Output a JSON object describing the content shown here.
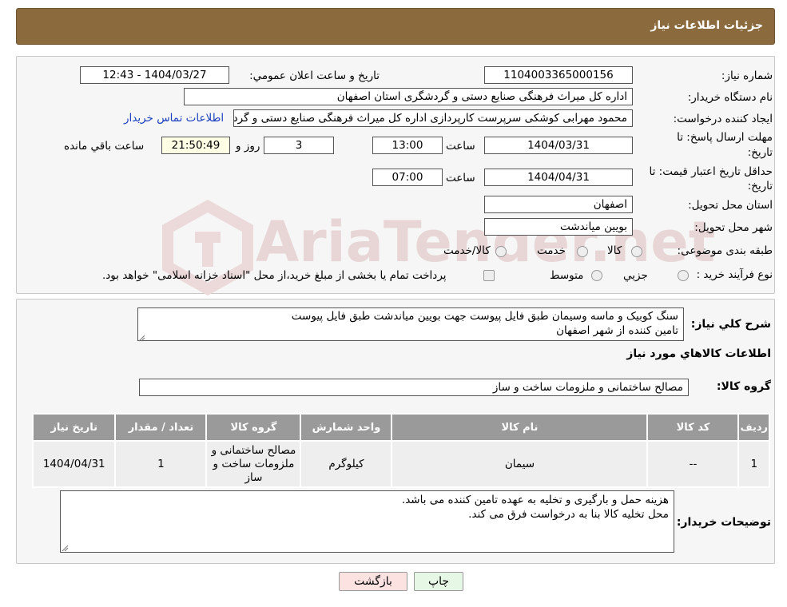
{
  "header": {
    "title": "جزئیات اطلاعات نیاز"
  },
  "info": {
    "need_number_label": "شماره نیاز:",
    "need_number": "1104003365000156",
    "announce_label": "تاریخ و ساعت اعلان عمومي:",
    "announce_value": "1404/03/27 - 12:43",
    "buyer_label": "نام دستگاه خريدار:",
    "buyer_value": "اداره کل میراث فرهنگی  صنایع دستی و گردشگری استان اصفهان",
    "creator_label": "ايجاد کننده درخواست:",
    "creator_value": "محمود مهرابی کوشکی سرپرست کارپردازی اداره کل میراث فرهنگی  صنایع دستی و گردشگری",
    "contact_link": "اطلاعات تماس خريدار",
    "reply_label_1": "مهلت ارسال پاسخ: تا",
    "reply_label_2": "تاريخ:",
    "reply_date": "1404/03/31",
    "time_label": "ساعت",
    "reply_time": "13:00",
    "days_value": "3",
    "days_label": "روز و",
    "remaining_time": "21:50:49",
    "remaining_label": "ساعت باقي مانده",
    "validity_label_1": "حداقل تاريخ اعتبار قيمت: تا",
    "validity_label_2": "تاريخ:",
    "validity_date": "1404/04/31",
    "validity_time": "07:00",
    "province_label": "استان محل تحويل:",
    "province_value": "اصفهان",
    "city_label": "شهر محل تحويل:",
    "city_value": "بویین میاندشت",
    "category_label": "طبقه بندی موضوعی:",
    "category_options": [
      "کالا",
      "خدمت",
      "کالا/خدمت"
    ],
    "process_label": "نوع فرآيند خريد :",
    "process_options": [
      "جزيي",
      "متوسط"
    ],
    "process_note": "پرداخت تمام يا بخشی از مبلغ خريد،از محل \"اسناد خزانه اسلامی\" خواهد بود."
  },
  "watermark": "AriaTender.net",
  "details": {
    "summary_label": "شرح کلي نياز:",
    "summary_line1": "سنگ کوبیک و ماسه وسیمان طبق فایل پیوست جهت بویین میاندشت طبق فایل پیوست",
    "summary_line2": "تامین کننده از شهر اصفهان",
    "goods_title": "اطلاعات کالاهاي مورد نياز",
    "group_label": "گروه کالا:",
    "group_value": "مصالح ساختمانی و ملزومات ساخت و ساز",
    "table": {
      "headers": [
        "رديف",
        "کد کالا",
        "نام کالا",
        "واحد شمارش",
        "گروه کالا",
        "تعداد / مقدار",
        "تاريخ نياز"
      ],
      "rows": [
        [
          "1",
          "--",
          "سیمان",
          "کیلوگرم",
          "مصالح ساختمانی و ملزومات ساخت و ساز",
          "1",
          "1404/04/31"
        ]
      ]
    },
    "buyer_notes_label": "توضيحات خريدار:",
    "buyer_notes_line1": "هزینه حمل و بارگیری و تخلیه به عهده تامین کننده می باشد.",
    "buyer_notes_line2": "محل تخلیه کالا بنا به درخواست فرق می کند."
  },
  "buttons": {
    "print": "چاپ",
    "back": "بازگشت"
  },
  "colors": {
    "header": "#8b6b3d",
    "back_button": "#fde2e2",
    "print_button": "#e6f7e6"
  }
}
